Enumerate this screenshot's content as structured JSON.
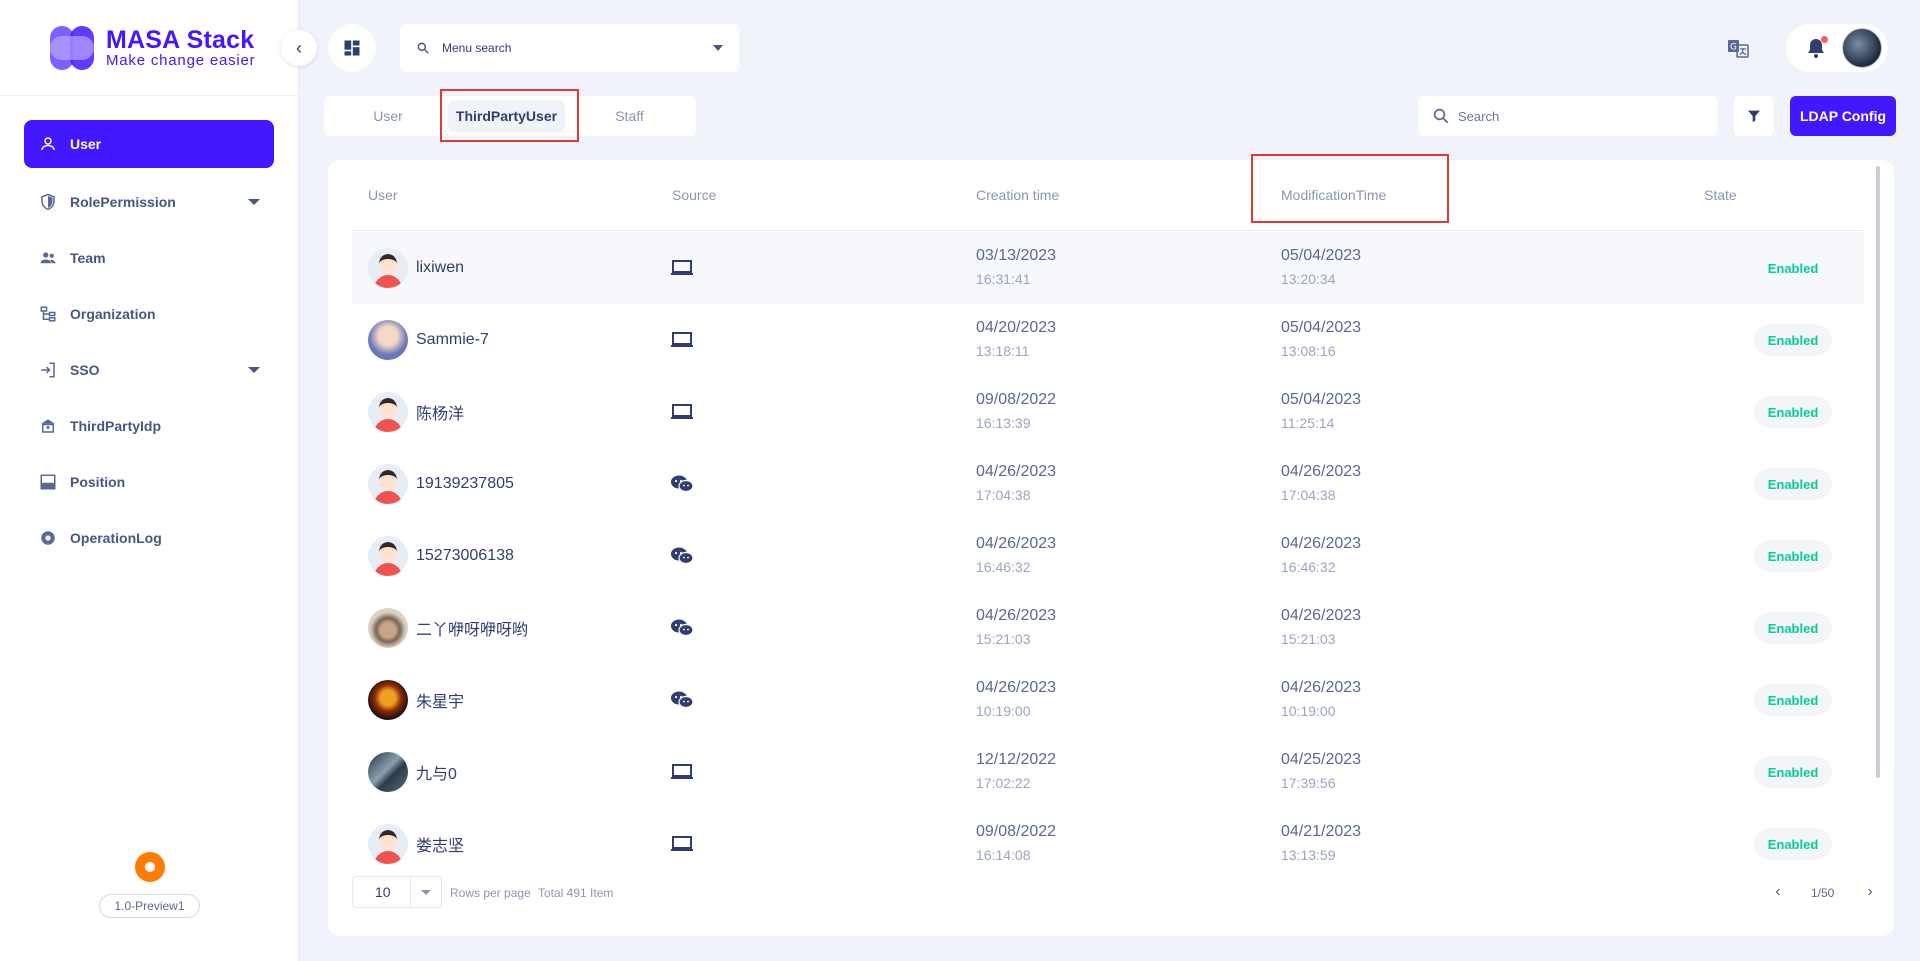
{
  "brand": {
    "name": "MASA Stack",
    "slogan": "Make change easier"
  },
  "sidebar": {
    "items": [
      {
        "label": "User",
        "icon": "user-icon",
        "active": true
      },
      {
        "label": "RolePermission",
        "icon": "shield-icon",
        "expandable": true
      },
      {
        "label": "Team",
        "icon": "team-icon"
      },
      {
        "label": "Organization",
        "icon": "organization-icon"
      },
      {
        "label": "SSO",
        "icon": "login-icon",
        "expandable": true
      },
      {
        "label": "ThirdPartyIdp",
        "icon": "idp-icon"
      },
      {
        "label": "Position",
        "icon": "position-icon"
      },
      {
        "label": "OperationLog",
        "icon": "record-icon"
      }
    ],
    "version": "1.0-Preview1"
  },
  "topbar": {
    "menu_search_placeholder": "Menu search"
  },
  "tabs": [
    {
      "label": "User"
    },
    {
      "label": "ThirdPartyUser",
      "active": true
    },
    {
      "label": "Staff"
    }
  ],
  "toolbar": {
    "search_placeholder": "Search",
    "ldap_label": "LDAP Config"
  },
  "table": {
    "headers": {
      "user": "User",
      "source": "Source",
      "creation": "Creation time",
      "modification": "ModificationTime",
      "state": "State"
    },
    "rows": [
      {
        "user": "lixiwen",
        "source": "computer-icon",
        "c_date": "03/13/2023",
        "c_time": "16:31:41",
        "m_date": "05/04/2023",
        "m_time": "13:20:34",
        "state": "Enabled"
      },
      {
        "user": "Sammie-7",
        "source": "computer-icon",
        "c_date": "04/20/2023",
        "c_time": "13:18:11",
        "m_date": "05/04/2023",
        "m_time": "13:08:16",
        "state": "Enabled"
      },
      {
        "user": "陈杨洋",
        "source": "computer-icon",
        "c_date": "09/08/2022",
        "c_time": "16:13:39",
        "m_date": "05/04/2023",
        "m_time": "11:25:14",
        "state": "Enabled"
      },
      {
        "user": "19139237805",
        "source": "wechat-icon",
        "c_date": "04/26/2023",
        "c_time": "17:04:38",
        "m_date": "04/26/2023",
        "m_time": "17:04:38",
        "state": "Enabled"
      },
      {
        "user": "15273006138",
        "source": "wechat-icon",
        "c_date": "04/26/2023",
        "c_time": "16:46:32",
        "m_date": "04/26/2023",
        "m_time": "16:46:32",
        "state": "Enabled"
      },
      {
        "user": "二丫咿呀咿呀哟",
        "source": "wechat-icon",
        "c_date": "04/26/2023",
        "c_time": "15:21:03",
        "m_date": "04/26/2023",
        "m_time": "15:21:03",
        "state": "Enabled"
      },
      {
        "user": "朱星宇",
        "source": "wechat-icon",
        "c_date": "04/26/2023",
        "c_time": "10:19:00",
        "m_date": "04/26/2023",
        "m_time": "10:19:00",
        "state": "Enabled"
      },
      {
        "user": "九与0",
        "source": "computer-icon",
        "c_date": "12/12/2022",
        "c_time": "17:02:22",
        "m_date": "04/25/2023",
        "m_time": "17:39:56",
        "state": "Enabled"
      },
      {
        "user": "娄志坚",
        "source": "computer-icon",
        "c_date": "09/08/2022",
        "c_time": "16:14:08",
        "m_date": "04/21/2023",
        "m_time": "13:13:59",
        "state": "Enabled"
      }
    ]
  },
  "pagination": {
    "rows_per_page": "10",
    "rows_label": "Rows per page",
    "total_label": "Total 491 Item",
    "page_text": "1/50"
  },
  "colors": {
    "primary": "#4318ff",
    "enabled": "#05cd99",
    "annotation": "#e53935"
  }
}
